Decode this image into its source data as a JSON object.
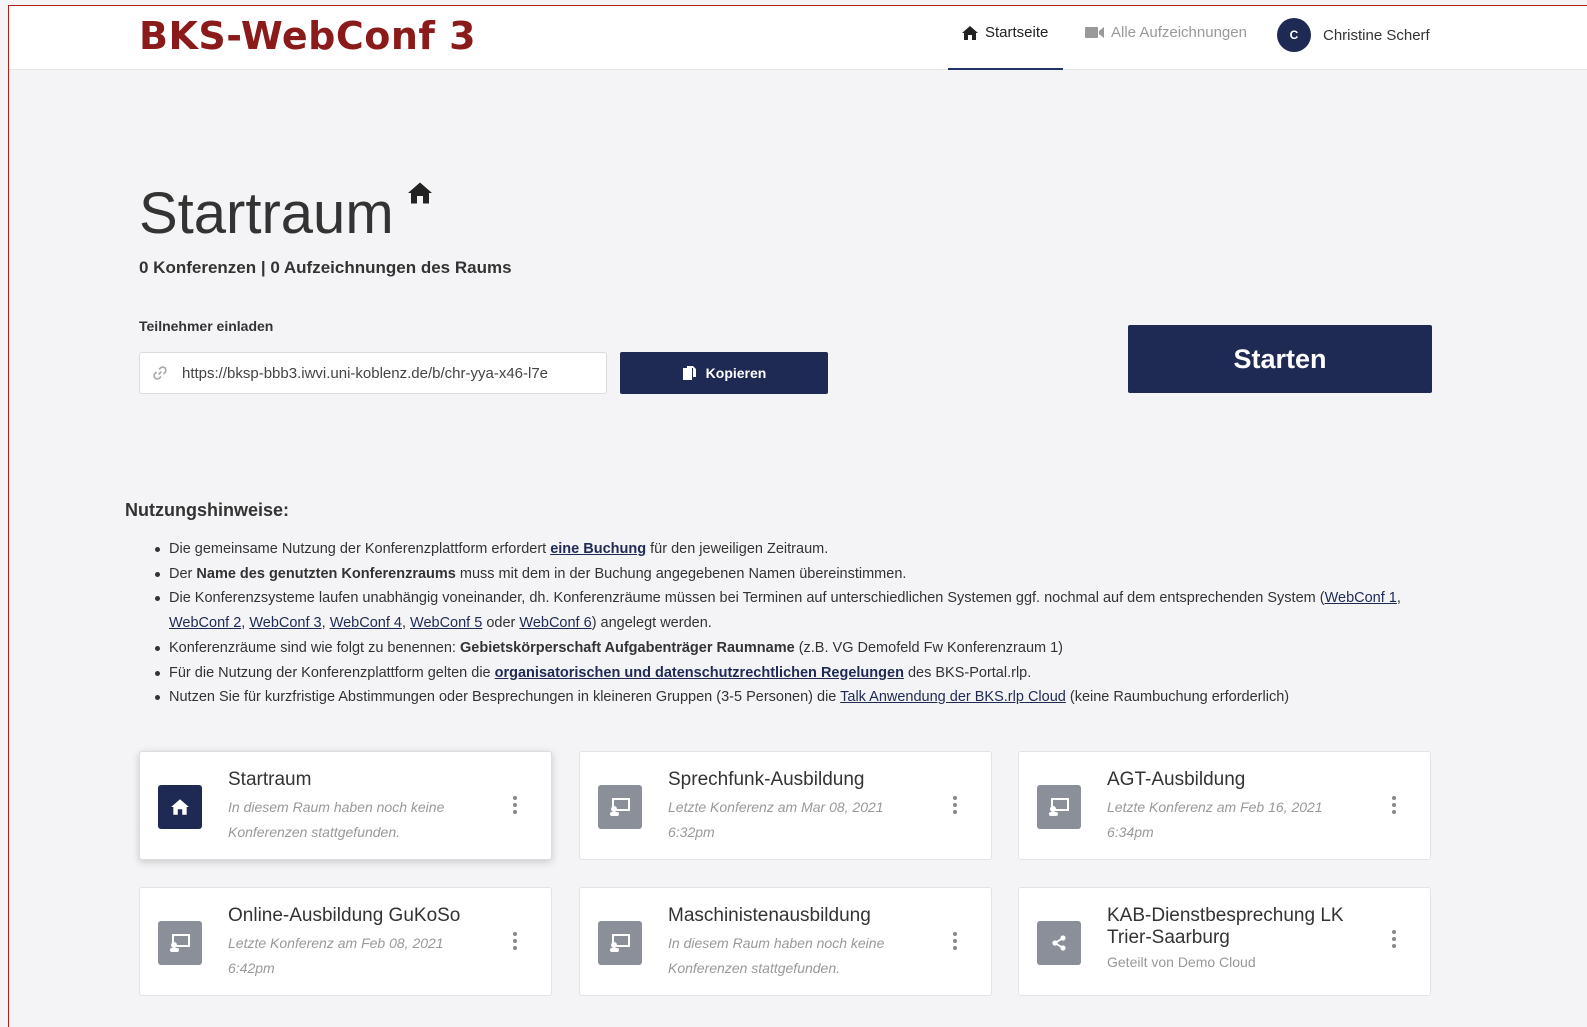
{
  "header": {
    "brand": "BKS-WebConf 3",
    "nav_home": "Startseite",
    "nav_recordings": "Alle Aufzeichnungen",
    "user_initial": "C",
    "user_name": "Christine Scherf"
  },
  "room": {
    "title": "Startraum",
    "stats_conferences": "0 Konferenzen",
    "stats_separator": " | ",
    "stats_recordings": "0 Aufzeichnungen des Raums",
    "invite_label": "Teilnehmer einladen",
    "invite_url": "https://bksp-bbb3.iwvi.uni-koblenz.de/b/chr-yya-x46-l7e",
    "copy_label": "Kopieren",
    "start_label": "Starten"
  },
  "notes": {
    "title": "Nutzungshinweise:",
    "n1_a": "Die gemeinsame Nutzung der Konferenzplattform erfordert ",
    "n1_link": "eine Buchung",
    "n1_b": " für den jeweiligen Zeitraum.",
    "n2_a": "Der ",
    "n2_bold": "Name des genutzten Konferenzraums",
    "n2_b": " muss mit dem in der Buchung angegebenen Namen übereinstimmen.",
    "n3_a": "Die Konferenzsysteme laufen unabhängig voneinander, dh. Konferenzräume müssen bei Terminen auf unterschiedlichen Systemen ggf. nochmal auf dem entsprechenden System (",
    "n3_l1": "WebConf 1",
    "n3_l2": "WebConf 2",
    "n3_l3": "WebConf 3",
    "n3_l4": "WebConf 4",
    "n3_l5": "WebConf 5",
    "n3_or": " oder ",
    "n3_l6": "WebConf 6",
    "n3_b": ") angelegt werden.",
    "n4_a": "Konferenzräume sind wie folgt zu benennen: ",
    "n4_bold": "Gebietskörperschaft Aufgabenträger Raumname",
    "n4_b": " (z.B. VG Demofeld Fw Konferenzraum 1)",
    "n5_a": "Für die Nutzung der Konferenzplattform gelten die ",
    "n5_link": "organisatorischen und datenschutzrechtlichen Regelungen",
    "n5_b": " des BKS-Portal.rlp.",
    "n6_a": "Nutzen Sie für kurzfristige Abstimmungen oder Besprechungen in kleineren Gruppen (3-5 Personen) die ",
    "n6_link": "Talk Anwendung der BKS.rlp Cloud",
    "n6_b": " (keine Raumbuchung erforderlich)"
  },
  "rooms": [
    {
      "name": "Startraum",
      "sub1": "In diesem Raum haben noch keine",
      "sub2": "Konferenzen stattgefunden.",
      "icon": "home-icon"
    },
    {
      "name": "Sprechfunk-Ausbildung",
      "sub1": "Letzte Konferenz am Mar 08, 2021",
      "sub2": "6:32pm",
      "icon": "presentation-icon"
    },
    {
      "name": "AGT-Ausbildung",
      "sub1": "Letzte Konferenz am Feb 16, 2021",
      "sub2": "6:34pm",
      "icon": "presentation-icon"
    },
    {
      "name": "Online-Ausbildung GuKoSo",
      "sub1": "Letzte Konferenz am Feb 08, 2021",
      "sub2": "6:42pm",
      "icon": "presentation-icon"
    },
    {
      "name": "Maschinistenausbildung",
      "sub1": "In diesem Raum haben noch keine",
      "sub2": "Konferenzen stattgefunden.",
      "icon": "presentation-icon"
    },
    {
      "name": "KAB-Dienstbesprechung LK Trier-Saarburg",
      "sub1": "Geteilt von Demo Cloud",
      "icon": "share-icon"
    }
  ],
  "colors": {
    "brand": "#8b1a1a",
    "primary": "#1e2a54",
    "icon_gray": "#8a8f99"
  }
}
